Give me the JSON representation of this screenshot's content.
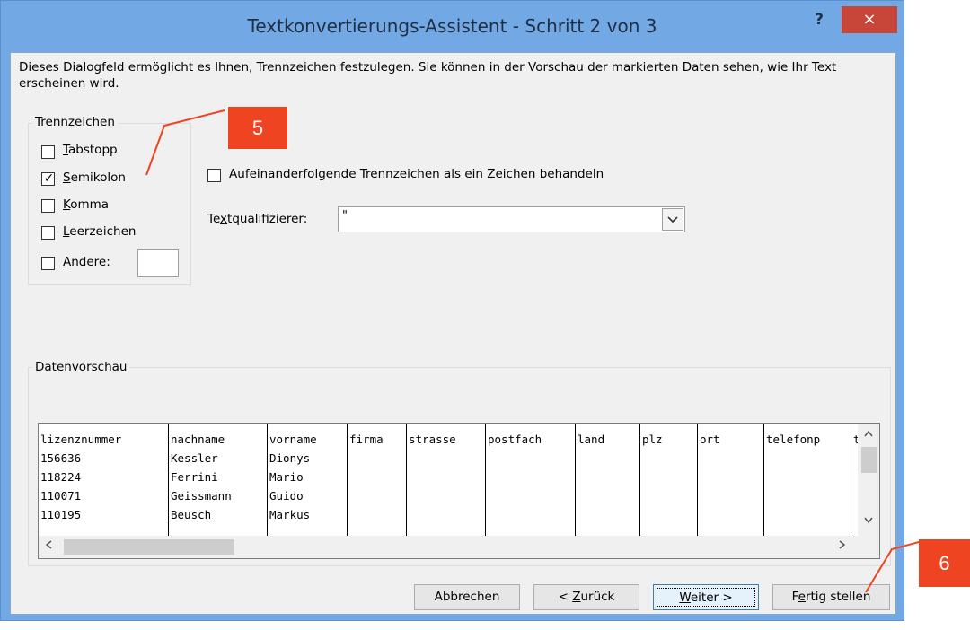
{
  "window": {
    "title": "Textkonvertierungs-Assistent - Schritt 2 von 3",
    "help_label": "?",
    "close_label": "×"
  },
  "description": "Dieses Dialogfeld ermöglicht es Ihnen, Trennzeichen festzulegen. Sie können in der Vorschau der markierten Daten sehen, wie Ihr Text erscheinen wird.",
  "trennzeichen": {
    "legend": "Trennzeichen",
    "options": [
      {
        "key": "T",
        "rest": "abstopp",
        "checked": false
      },
      {
        "key": "S",
        "rest": "emikolon",
        "checked": true
      },
      {
        "key": "K",
        "rest": "omma",
        "checked": false
      },
      {
        "key": "L",
        "rest": "eerzeichen",
        "checked": false
      },
      {
        "key": "A",
        "rest": "ndere:",
        "checked": false
      }
    ],
    "andere_value": ""
  },
  "consecutive": {
    "pre": "A",
    "key": "u",
    "post": "feinanderfolgende Trennzeichen als ein Zeichen behandeln",
    "checked": false
  },
  "qualifier": {
    "pre": "Te",
    "key": "x",
    "post": "tqualifizierer:",
    "value": "\""
  },
  "preview": {
    "legend_pre": "Datenvors",
    "legend_key": "c",
    "legend_post": "hau",
    "columns": [
      "lizenznummer",
      "nachname",
      "vorname",
      "firma",
      "strasse",
      "postfach",
      "land",
      "plz",
      "ort",
      "telefonp",
      "tele"
    ],
    "rows": [
      [
        "156636",
        "Kessler",
        "Dionys",
        "",
        "",
        "",
        "",
        "",
        "",
        "",
        ""
      ],
      [
        "118224",
        "Ferrini",
        "Mario",
        "",
        "",
        "",
        "",
        "",
        "",
        "",
        ""
      ],
      [
        "110071",
        "Geissmann",
        "Guido",
        "",
        "",
        "",
        "",
        "",
        "",
        "",
        ""
      ],
      [
        "110195",
        "Beusch",
        "Markus",
        "",
        "",
        "",
        "",
        "",
        "",
        "",
        ""
      ]
    ]
  },
  "buttons": {
    "abbrechen": "Abbrechen",
    "zurueck": {
      "pre": "< ",
      "key": "Z",
      "post": "urück"
    },
    "weiter": {
      "pre": "",
      "key": "W",
      "post": "eiter >"
    },
    "fertig": {
      "pre": "F",
      "key": "e",
      "post": "rtig stellen"
    }
  },
  "callouts": {
    "step5": "5",
    "step6": "6",
    "color": "#ee4422"
  },
  "icons": {
    "check": "✓",
    "dropdown": "chevron-down-icon",
    "scroll_up": "▲",
    "scroll_down": "▼",
    "scroll_left": "◀",
    "scroll_right": "▶"
  }
}
